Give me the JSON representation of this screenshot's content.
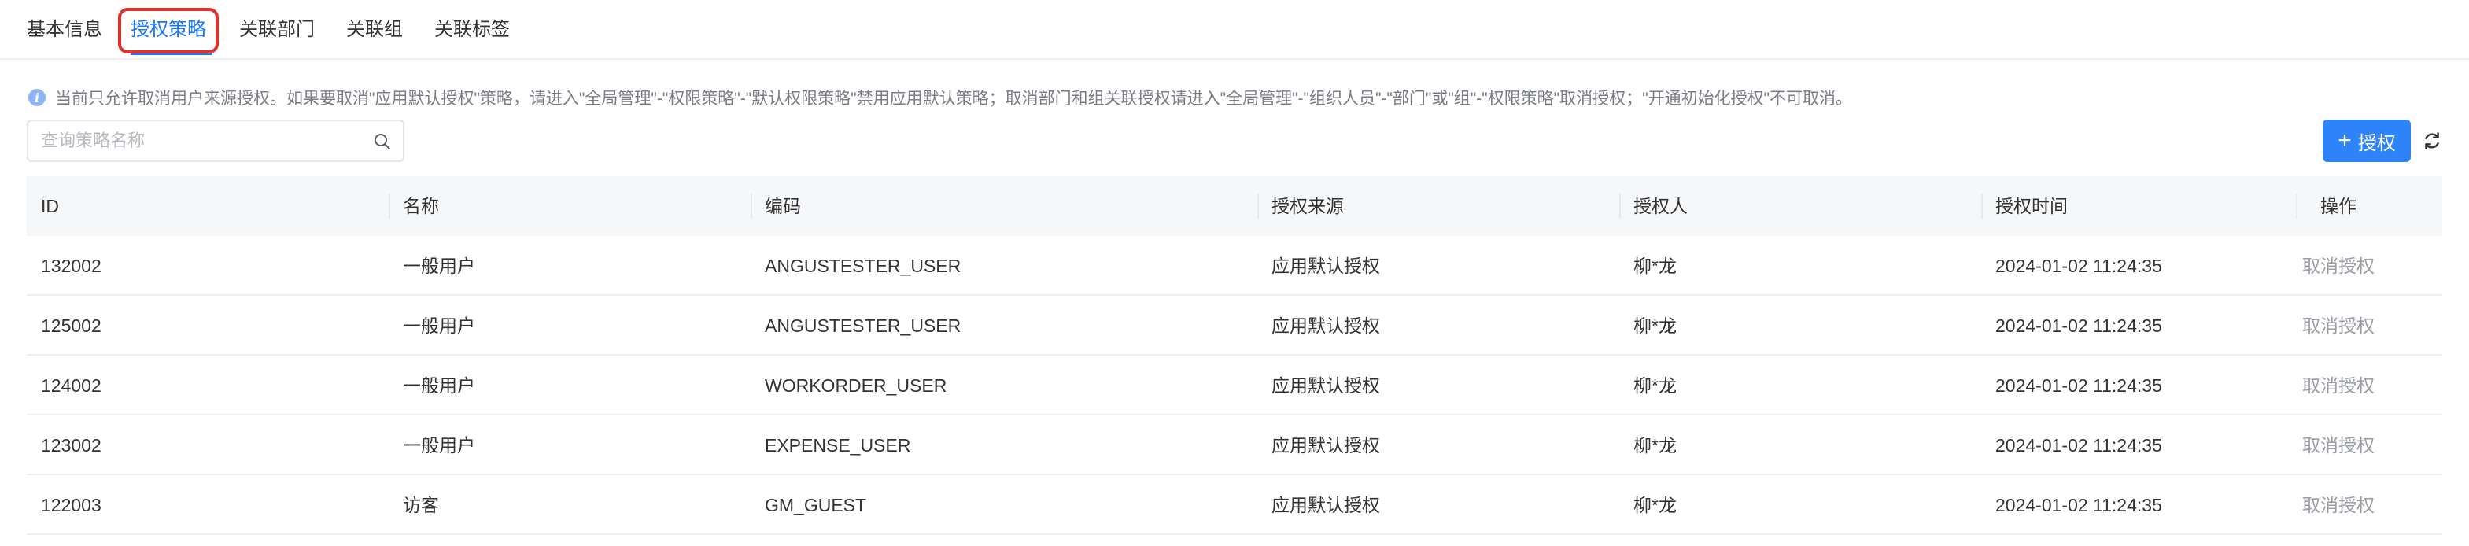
{
  "tabs": [
    {
      "label": "基本信息",
      "active": false
    },
    {
      "label": "授权策略",
      "active": true
    },
    {
      "label": "关联部门",
      "active": false
    },
    {
      "label": "关联组",
      "active": false
    },
    {
      "label": "关联标签",
      "active": false
    }
  ],
  "notice": {
    "icon": "info-icon",
    "text": "当前只允许取消用户来源授权。如果要取消\"应用默认授权\"策略，请进入\"全局管理\"-\"权限策略\"-\"默认权限策略\"禁用应用默认策略；取消部门和组关联授权请进入\"全局管理\"-\"组织人员\"-\"部门\"或\"组\"-\"权限策略\"取消授权；\"开通初始化授权\"不可取消。"
  },
  "search": {
    "placeholder": "查询策略名称",
    "value": ""
  },
  "toolbar": {
    "add_label": "授权",
    "add_icon": "+",
    "refresh_icon": "refresh-icon"
  },
  "table": {
    "columns": [
      "ID",
      "名称",
      "编码",
      "授权来源",
      "授权人",
      "授权时间",
      "操作"
    ],
    "rows": [
      {
        "id": "132002",
        "name": "一般用户",
        "code": "ANGUSTESTER_USER",
        "source": "应用默认授权",
        "user": "柳*龙",
        "time": "2024-01-02 11:24:35",
        "action": "取消授权"
      },
      {
        "id": "125002",
        "name": "一般用户",
        "code": "ANGUSTESTER_USER",
        "source": "应用默认授权",
        "user": "柳*龙",
        "time": "2024-01-02 11:24:35",
        "action": "取消授权"
      },
      {
        "id": "124002",
        "name": "一般用户",
        "code": "WORKORDER_USER",
        "source": "应用默认授权",
        "user": "柳*龙",
        "time": "2024-01-02 11:24:35",
        "action": "取消授权"
      },
      {
        "id": "123002",
        "name": "一般用户",
        "code": "EXPENSE_USER",
        "source": "应用默认授权",
        "user": "柳*龙",
        "time": "2024-01-02 11:24:35",
        "action": "取消授权"
      },
      {
        "id": "122003",
        "name": "访客",
        "code": "GM_GUEST",
        "source": "应用默认授权",
        "user": "柳*龙",
        "time": "2024-01-02 11:24:35",
        "action": "取消授权"
      }
    ]
  },
  "colors": {
    "accent": "#1677ff",
    "button": "#2d83f7",
    "highlight": "#e0322d",
    "muted_text": "#7a7d85",
    "header_bg": "#f6f7f9"
  }
}
